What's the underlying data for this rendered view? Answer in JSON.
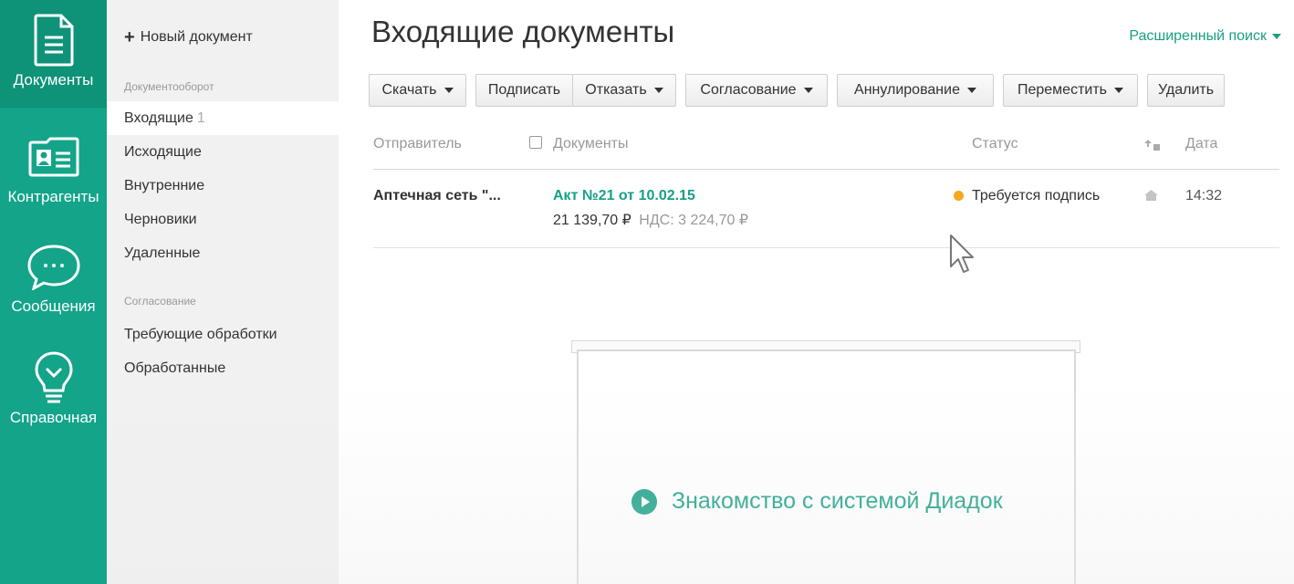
{
  "rail": {
    "items": [
      {
        "label": "Документы",
        "icon": "document-icon",
        "active": true
      },
      {
        "label": "Контрагенты",
        "icon": "contact-card-icon",
        "active": false
      },
      {
        "label": "Сообщения",
        "icon": "chat-bubble-icon",
        "active": false
      },
      {
        "label": "Справочная",
        "icon": "lightbulb-icon",
        "active": false
      }
    ]
  },
  "sidebar": {
    "new_document": "Новый документ",
    "section_docflow": "Документооборот",
    "docflow_items": [
      {
        "label": "Входящие",
        "count": "1"
      },
      {
        "label": "Исходящие"
      },
      {
        "label": "Внутренние"
      },
      {
        "label": "Черновики"
      },
      {
        "label": "Удаленные"
      }
    ],
    "section_approval": "Согласование",
    "approval_items": [
      {
        "label": "Требующие обработки"
      },
      {
        "label": "Обработанные"
      }
    ]
  },
  "main": {
    "title": "Входящие документы",
    "advanced_search": "Расширенный поиск",
    "toolbar": {
      "download": "Скачать",
      "sign": "Подписать",
      "reject": "Отказать",
      "approval": "Согласование",
      "annul": "Аннулирование",
      "move": "Переместить",
      "delete": "Удалить"
    },
    "columns": {
      "sender": "Отправитель",
      "documents": "Документы",
      "status": "Статус",
      "date": "Дата"
    },
    "rows": [
      {
        "sender": "Аптечная сеть \"...",
        "document": "Акт №21 от 10.02.15",
        "amount": "21 139,70 ₽",
        "vat": "НДС: 3 224,70 ₽",
        "status": "Требуется подпись",
        "status_color": "#f3a821",
        "time": "14:32"
      }
    ],
    "intro": "Знакомство с системой Диадок"
  },
  "colors": {
    "accent": "#17a086",
    "rail": "#13a48a"
  }
}
